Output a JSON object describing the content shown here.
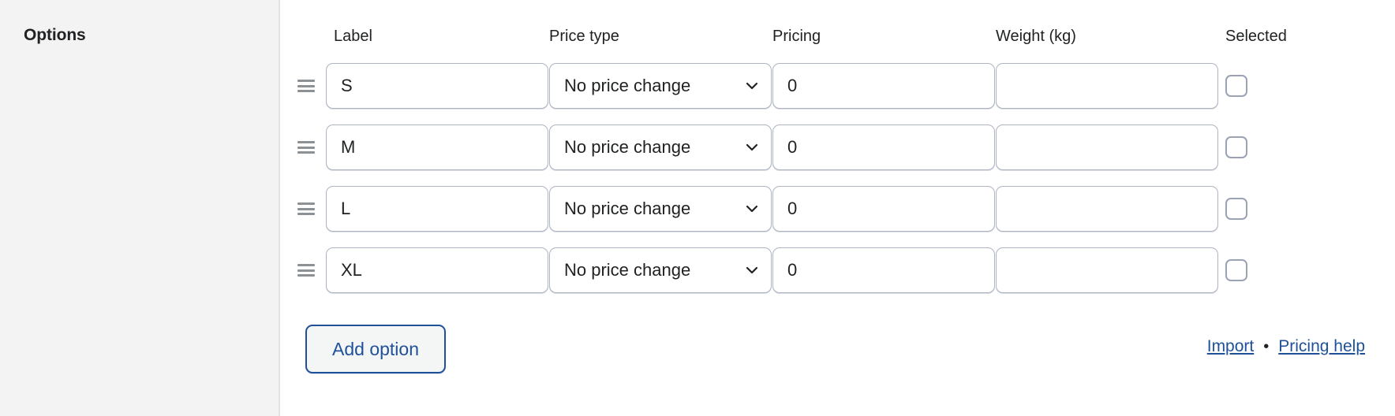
{
  "sidebar": {
    "title": "Options"
  },
  "table": {
    "columns": [
      {
        "key": "drag",
        "label": ""
      },
      {
        "key": "label",
        "label": "Label"
      },
      {
        "key": "price_type",
        "label": "Price type"
      },
      {
        "key": "pricing",
        "label": "Pricing"
      },
      {
        "key": "weight",
        "label": "Weight (kg)"
      },
      {
        "key": "selected",
        "label": "Selected"
      }
    ],
    "rows": [
      {
        "label": "S",
        "label_placeholder": "",
        "price_type": "No price change",
        "pricing": "0",
        "pricing_placeholder": "",
        "weight": "",
        "weight_placeholder": "",
        "selected": false
      },
      {
        "label": "M",
        "label_placeholder": "",
        "price_type": "No price change",
        "pricing": "0",
        "pricing_placeholder": "",
        "weight": "",
        "weight_placeholder": "",
        "selected": false
      },
      {
        "label": "L",
        "label_placeholder": "",
        "price_type": "No price change",
        "pricing": "0",
        "pricing_placeholder": "",
        "weight": "",
        "weight_placeholder": "",
        "selected": false
      },
      {
        "label": "XL",
        "label_placeholder": "",
        "price_type": "No price change",
        "pricing": "0",
        "pricing_placeholder": "",
        "weight": "",
        "weight_placeholder": "",
        "selected": false
      }
    ]
  },
  "footer": {
    "add_option_label": "Add option",
    "import_link": "Import",
    "separator": "•",
    "pricing_help_link": "Pricing help"
  },
  "icons": {
    "drag_handle": "drag-handle-icon",
    "chevron_down": "chevron-down-icon"
  },
  "colors": {
    "sidebar_bg": "#f3f3f3",
    "divider": "#e1e3e5",
    "text": "#202223",
    "field_border": "#aeb4c2",
    "link_blue": "#1f5199",
    "checkbox_border": "#9aa2b5",
    "drag_handle": "#8c9196"
  }
}
